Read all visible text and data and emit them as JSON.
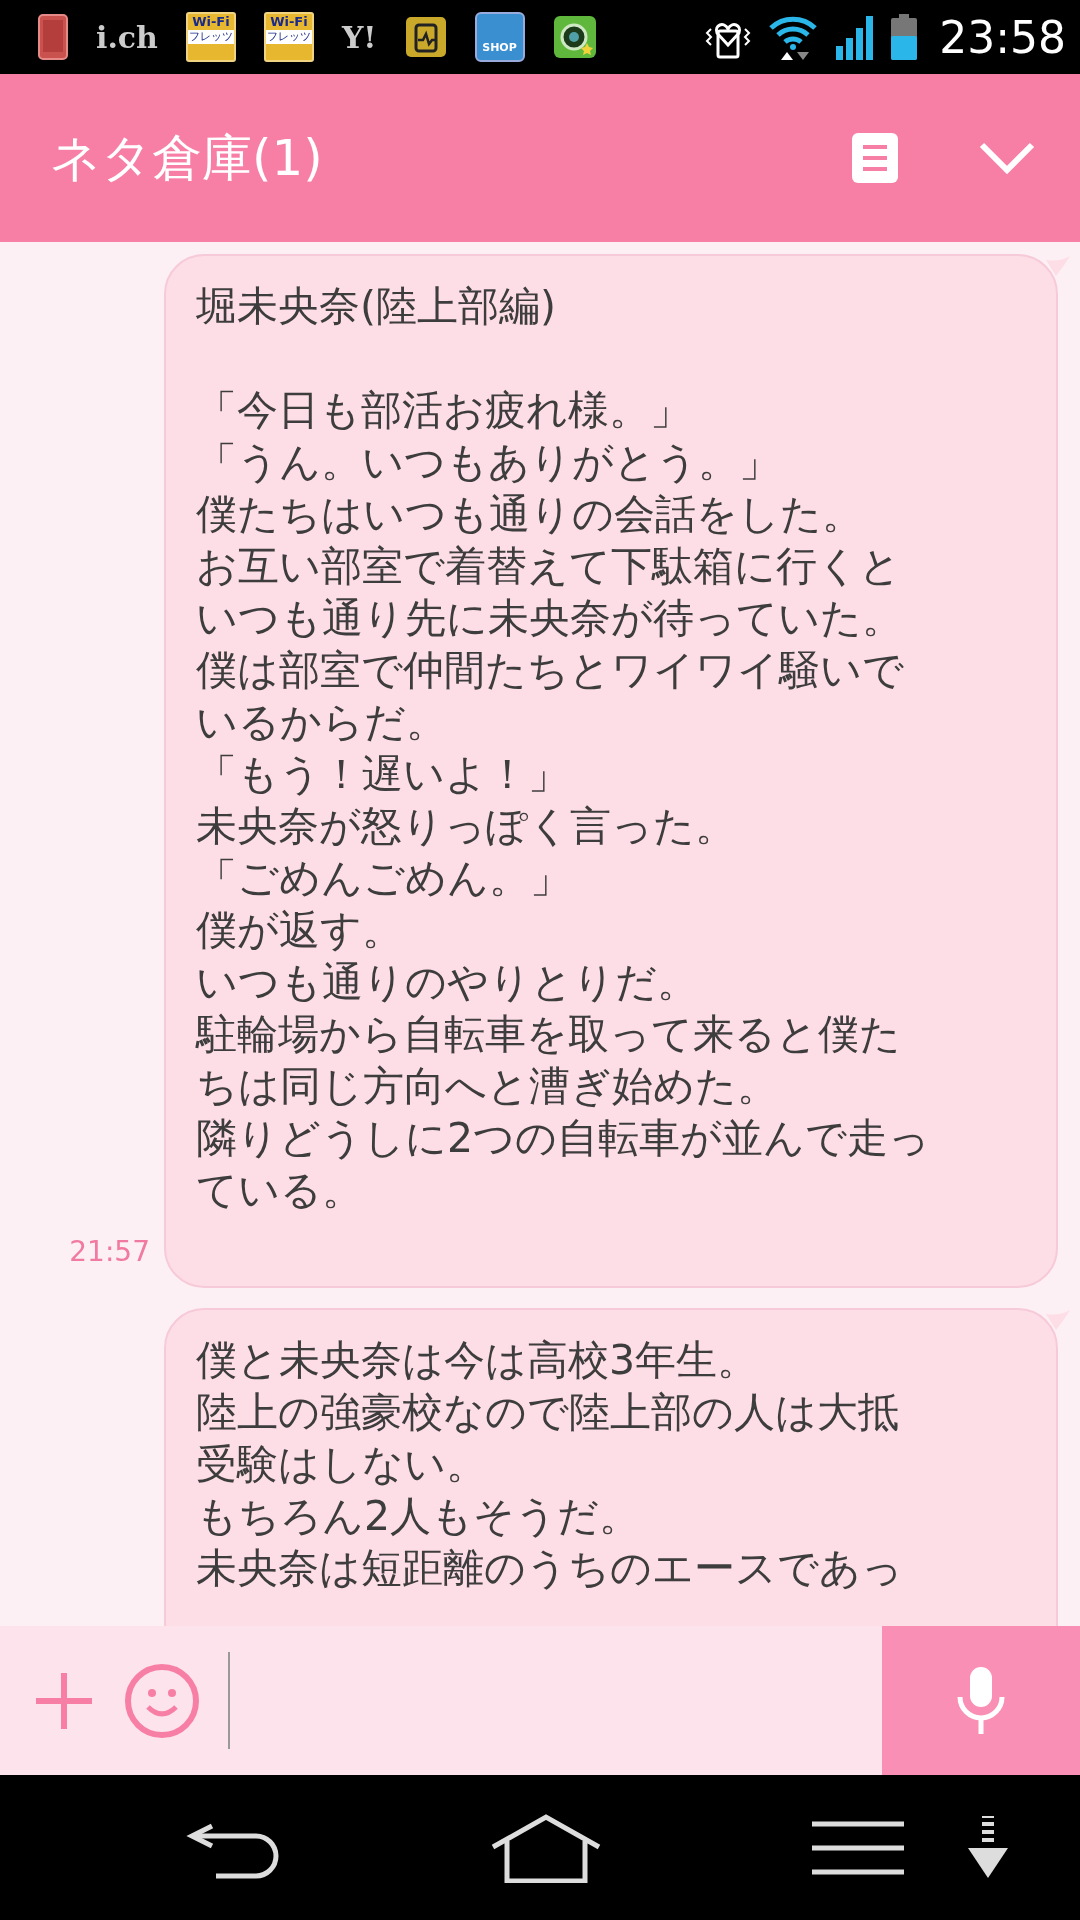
{
  "status_bar": {
    "app_icons": [
      {
        "kind": "phone"
      },
      {
        "kind": "text",
        "label": "i.ch"
      },
      {
        "kind": "wifi-spot",
        "label": "Wi-Fi",
        "sublabel": "フレッツ"
      },
      {
        "kind": "wifi-spot",
        "label": "Wi-Fi",
        "sublabel": "フレッツ"
      },
      {
        "kind": "text",
        "label": "Y!"
      },
      {
        "kind": "health"
      },
      {
        "kind": "shop",
        "label": "SHOP"
      },
      {
        "kind": "camera"
      }
    ],
    "time": "23:58"
  },
  "header": {
    "title": "ネタ倉庫(1)"
  },
  "messages": [
    {
      "heading": "堀未央奈(陸上部編)",
      "lines": [
        "「今日も部活お疲れ様。」",
        "「うん。いつもありがとう。」",
        "僕たちはいつも通りの会話をした。",
        "お互い部室で着替えて下駄箱に行くと",
        "いつも通り先に未央奈が待っていた。",
        "僕は部室で仲間たちとワイワイ騒いで",
        "いるからだ。",
        "「もう！遅いよ！」",
        "未央奈が怒りっぽく言った。",
        "「ごめんごめん。」",
        "僕が返す。",
        "いつも通りのやりとりだ。",
        "駐輪場から自転車を取って来ると僕た",
        "ちは同じ方向へと漕ぎ始めた。",
        "隣りどうしに2つの自転車が並んで走っ",
        "ている。"
      ],
      "time": "21:57"
    },
    {
      "lines": [
        "僕と未央奈は今は高校3年生。",
        "陸上の強豪校なので陸上部の人は大抵",
        "受験はしない。",
        "もちろん2人もそうだ。",
        "未央奈は短距離のうちのエースであっ"
      ]
    }
  ]
}
